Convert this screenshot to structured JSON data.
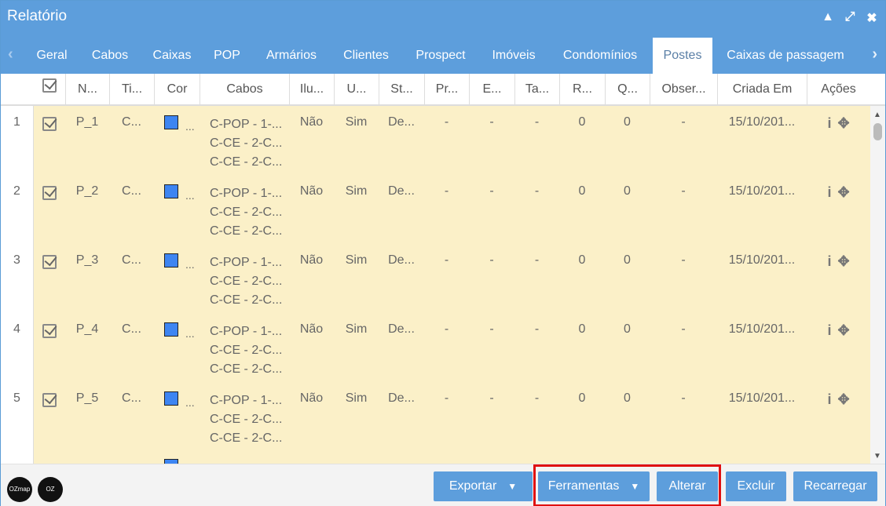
{
  "window": {
    "title": "Relatório",
    "controls": [
      "collapse-icon",
      "expand-icon",
      "close-icon"
    ]
  },
  "tabs": [
    "Geral",
    "Cabos",
    "Caixas",
    "POP",
    "Armários",
    "Clientes",
    "Prospect",
    "Imóveis",
    "Condomínios",
    "Postes",
    "Caixas de passagem"
  ],
  "active_tab": "Postes",
  "columns": [
    "N...",
    "Ti...",
    "Cor",
    "Cabos",
    "Ilu...",
    "U...",
    "St...",
    "Pr...",
    "E...",
    "Ta...",
    "R...",
    "Q...",
    "Obser...",
    "Criada Em",
    "Ações"
  ],
  "rows": [
    {
      "num": "1",
      "name": "P_1",
      "tipo": "C...",
      "cabos": [
        "C-POP - 1-...",
        "C-CE - 2-C...",
        "C-CE - 2-C..."
      ],
      "ilum": "Não",
      "u": "Sim",
      "st": "De...",
      "pr": "-",
      "e": "-",
      "ta": "-",
      "r": "0",
      "q": "0",
      "obs": "-",
      "criada": "15/10/201..."
    },
    {
      "num": "2",
      "name": "P_2",
      "tipo": "C...",
      "cabos": [
        "C-POP - 1-...",
        "C-CE - 2-C...",
        "C-CE - 2-C..."
      ],
      "ilum": "Não",
      "u": "Sim",
      "st": "De...",
      "pr": "-",
      "e": "-",
      "ta": "-",
      "r": "0",
      "q": "0",
      "obs": "-",
      "criada": "15/10/201..."
    },
    {
      "num": "3",
      "name": "P_3",
      "tipo": "C...",
      "cabos": [
        "C-POP - 1-...",
        "C-CE - 2-C...",
        "C-CE - 2-C..."
      ],
      "ilum": "Não",
      "u": "Sim",
      "st": "De...",
      "pr": "-",
      "e": "-",
      "ta": "-",
      "r": "0",
      "q": "0",
      "obs": "-",
      "criada": "15/10/201..."
    },
    {
      "num": "4",
      "name": "P_4",
      "tipo": "C...",
      "cabos": [
        "C-POP - 1-...",
        "C-CE - 2-C...",
        "C-CE - 2-C..."
      ],
      "ilum": "Não",
      "u": "Sim",
      "st": "De...",
      "pr": "-",
      "e": "-",
      "ta": "-",
      "r": "0",
      "q": "0",
      "obs": "-",
      "criada": "15/10/201..."
    },
    {
      "num": "5",
      "name": "P_5",
      "tipo": "C...",
      "cabos": [
        "C-POP - 1-...",
        "C-CE - 2-C...",
        "C-CE - 2-C..."
      ],
      "ilum": "Não",
      "u": "Sim",
      "st": "De...",
      "pr": "-",
      "e": "-",
      "ta": "-",
      "r": "0",
      "q": "0",
      "obs": "-",
      "criada": "15/10/201..."
    }
  ],
  "row_color": "#3d85f2",
  "ellipsis": "...",
  "actions": {
    "info": "i",
    "locate": "✥"
  },
  "footer": {
    "logos": [
      "OZmap",
      "OZ"
    ],
    "buttons": {
      "exportar": "Exportar",
      "ferramentas": "Ferramentas",
      "alterar": "Alterar",
      "excluir": "Excluir",
      "recarregar": "Recarregar"
    }
  },
  "colors": {
    "header": "#5d9edc",
    "row_bg": "#fbf0c8",
    "highlight": "#e01010"
  }
}
